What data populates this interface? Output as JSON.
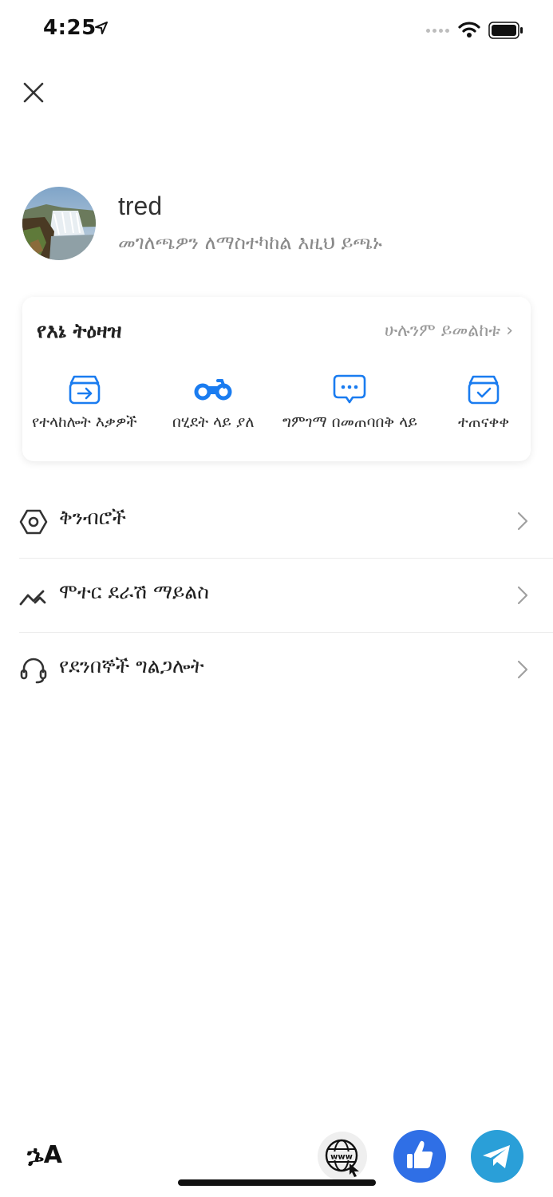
{
  "status_bar": {
    "time": "4:25"
  },
  "profile": {
    "username": "tred",
    "edit_hint": "መገለጫዎን ለማስተካከል እዚህ ይጫኑ"
  },
  "orders": {
    "title": "የእኔ ትዕዛዝ",
    "view_all": "ሁሉንም ይመልከቱ ›",
    "items": [
      {
        "label": "የተላከሎት እቃዎች",
        "icon": "box-arrow-icon"
      },
      {
        "label": "በሂደት ላይ ያለ",
        "icon": "motorcycle-icon"
      },
      {
        "label": "ግምገማ በመጠባበቅ ላይ",
        "icon": "chat-bubble-icon"
      },
      {
        "label": "ተጠናቀቀ",
        "icon": "box-check-icon"
      }
    ]
  },
  "menu": [
    {
      "label": "ቅንብሮች",
      "icon": "settings-hexagon-icon"
    },
    {
      "label": "ሞተር ደራሽ ማይልስ",
      "icon": "trend-icon"
    },
    {
      "label": "የደንበኞች ግልጋሎት",
      "icon": "headset-icon"
    }
  ],
  "bottom_bar": {
    "language_icon": "language-switch-icon",
    "language_glyph": "ኌA",
    "website_icon": "globe-www-icon",
    "website_text": "www",
    "like_icon": "thumbs-up-icon",
    "telegram_icon": "telegram-icon"
  },
  "colors": {
    "accent": "#1a7cf0",
    "like_button": "#2f6fe6",
    "telegram_button": "#2a9fd8",
    "muted_text": "#8a8a8a"
  }
}
